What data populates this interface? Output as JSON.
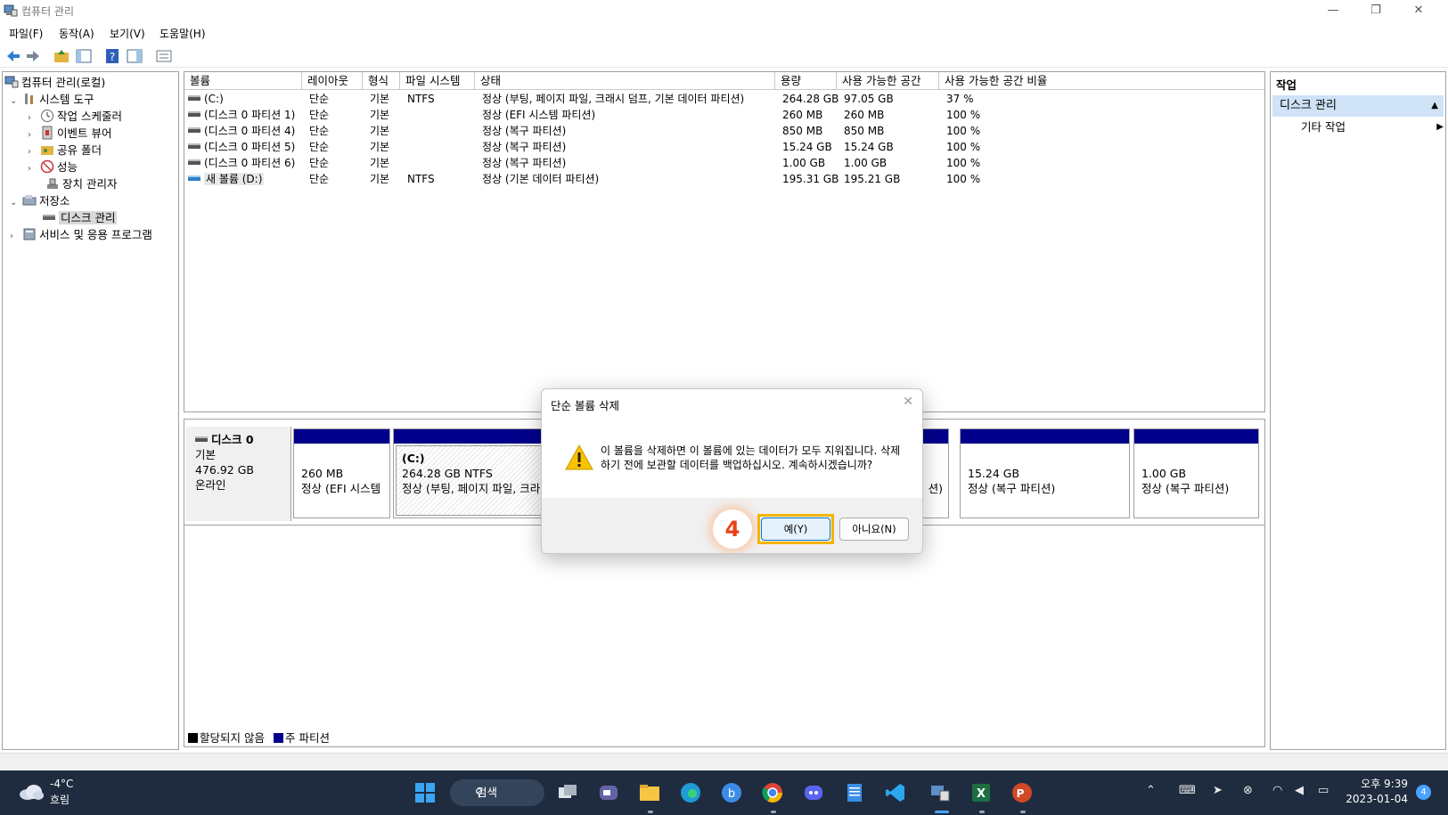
{
  "window": {
    "title": "컴퓨터 관리",
    "minimize": "—",
    "restore": "❐",
    "close": "✕"
  },
  "menu": [
    "파일(F)",
    "동작(A)",
    "보기(V)",
    "도움말(H)"
  ],
  "tree": [
    {
      "label": "컴퓨터 관리(로컬)",
      "expander": ""
    },
    {
      "label": "시스템 도구",
      "expander": "⌄"
    },
    {
      "label": "작업 스케줄러",
      "expander": "›"
    },
    {
      "label": "이벤트 뷰어",
      "expander": "›"
    },
    {
      "label": "공유 폴더",
      "expander": "›"
    },
    {
      "label": "성능",
      "expander": "›"
    },
    {
      "label": "장치 관리자",
      "expander": ""
    },
    {
      "label": "저장소",
      "expander": "⌄"
    },
    {
      "label": "디스크 관리",
      "expander": ""
    },
    {
      "label": "서비스 및 응용 프로그램",
      "expander": "›"
    }
  ],
  "volumes": {
    "headers": [
      "볼륨",
      "레이아웃",
      "형식",
      "파일 시스템",
      "상태",
      "용량",
      "사용 가능한 공간",
      "사용 가능한 공간 비율"
    ],
    "rows": [
      [
        "(C:)",
        "단순",
        "기본",
        "NTFS",
        "정상 (부팅, 페이지 파일, 크래시 덤프, 기본 데이터 파티션)",
        "264.28 GB",
        "97.05 GB",
        "37 %"
      ],
      [
        "(디스크 0 파티션 1)",
        "단순",
        "기본",
        "",
        "정상 (EFI 시스템 파티션)",
        "260 MB",
        "260 MB",
        "100 %"
      ],
      [
        "(디스크 0 파티션 4)",
        "단순",
        "기본",
        "",
        "정상 (복구 파티션)",
        "850 MB",
        "850 MB",
        "100 %"
      ],
      [
        "(디스크 0 파티션 5)",
        "단순",
        "기본",
        "",
        "정상 (복구 파티션)",
        "15.24 GB",
        "15.24 GB",
        "100 %"
      ],
      [
        "(디스크 0 파티션 6)",
        "단순",
        "기본",
        "",
        "정상 (복구 파티션)",
        "1.00 GB",
        "1.00 GB",
        "100 %"
      ],
      [
        "새 볼륨 (D:)",
        "단순",
        "기본",
        "NTFS",
        "정상 (기본 데이터 파티션)",
        "195.31 GB",
        "195.21 GB",
        "100 %"
      ]
    ]
  },
  "disk": {
    "name": "디스크 0",
    "type": "기본",
    "size": "476.92 GB",
    "status": "온라인",
    "partitions": [
      {
        "line1": "",
        "line2": "260 MB",
        "line3": "정상 (EFI 시스템"
      },
      {
        "line1": "(C:)",
        "line2": "264.28 GB NTFS",
        "line3": "정상 (부팅, 페이지 파일, 크라"
      },
      {
        "line1": "",
        "line2": "",
        "line3": "션)"
      },
      {
        "line1": "",
        "line2": "15.24 GB",
        "line3": "정상 (복구 파티션)"
      },
      {
        "line1": "",
        "line2": "1.00 GB",
        "line3": "정상 (복구 파티션)"
      }
    ],
    "legend": [
      "할당되지 않음",
      "주 파티션"
    ]
  },
  "actions": {
    "header": "작업",
    "section": "디스크 관리",
    "section_arrow": "▲",
    "sub": "기타 작업",
    "sub_arrow": "▶"
  },
  "dialog": {
    "title": "단순 볼륨 삭제",
    "close": "✕",
    "message": "이 볼륨을 삭제하면 이 볼륨에 있는 데이터가 모두 지워집니다. 삭제하기 전에 보관할 데이터를 백업하십시오. 계속하시겠습니까?",
    "yes": "예(Y)",
    "no": "아니요(N)",
    "step": "4"
  },
  "taskbar": {
    "temp": "-4°C",
    "condition": "흐림",
    "search": "검색",
    "time": "오후 9:39",
    "date": "2023-01-04",
    "notifications": "4"
  },
  "colors": {
    "primary_partition": "#00008b",
    "highlight": "#f5b400",
    "step_badge": "#e8421a",
    "taskbar": "#1f2c3f"
  }
}
